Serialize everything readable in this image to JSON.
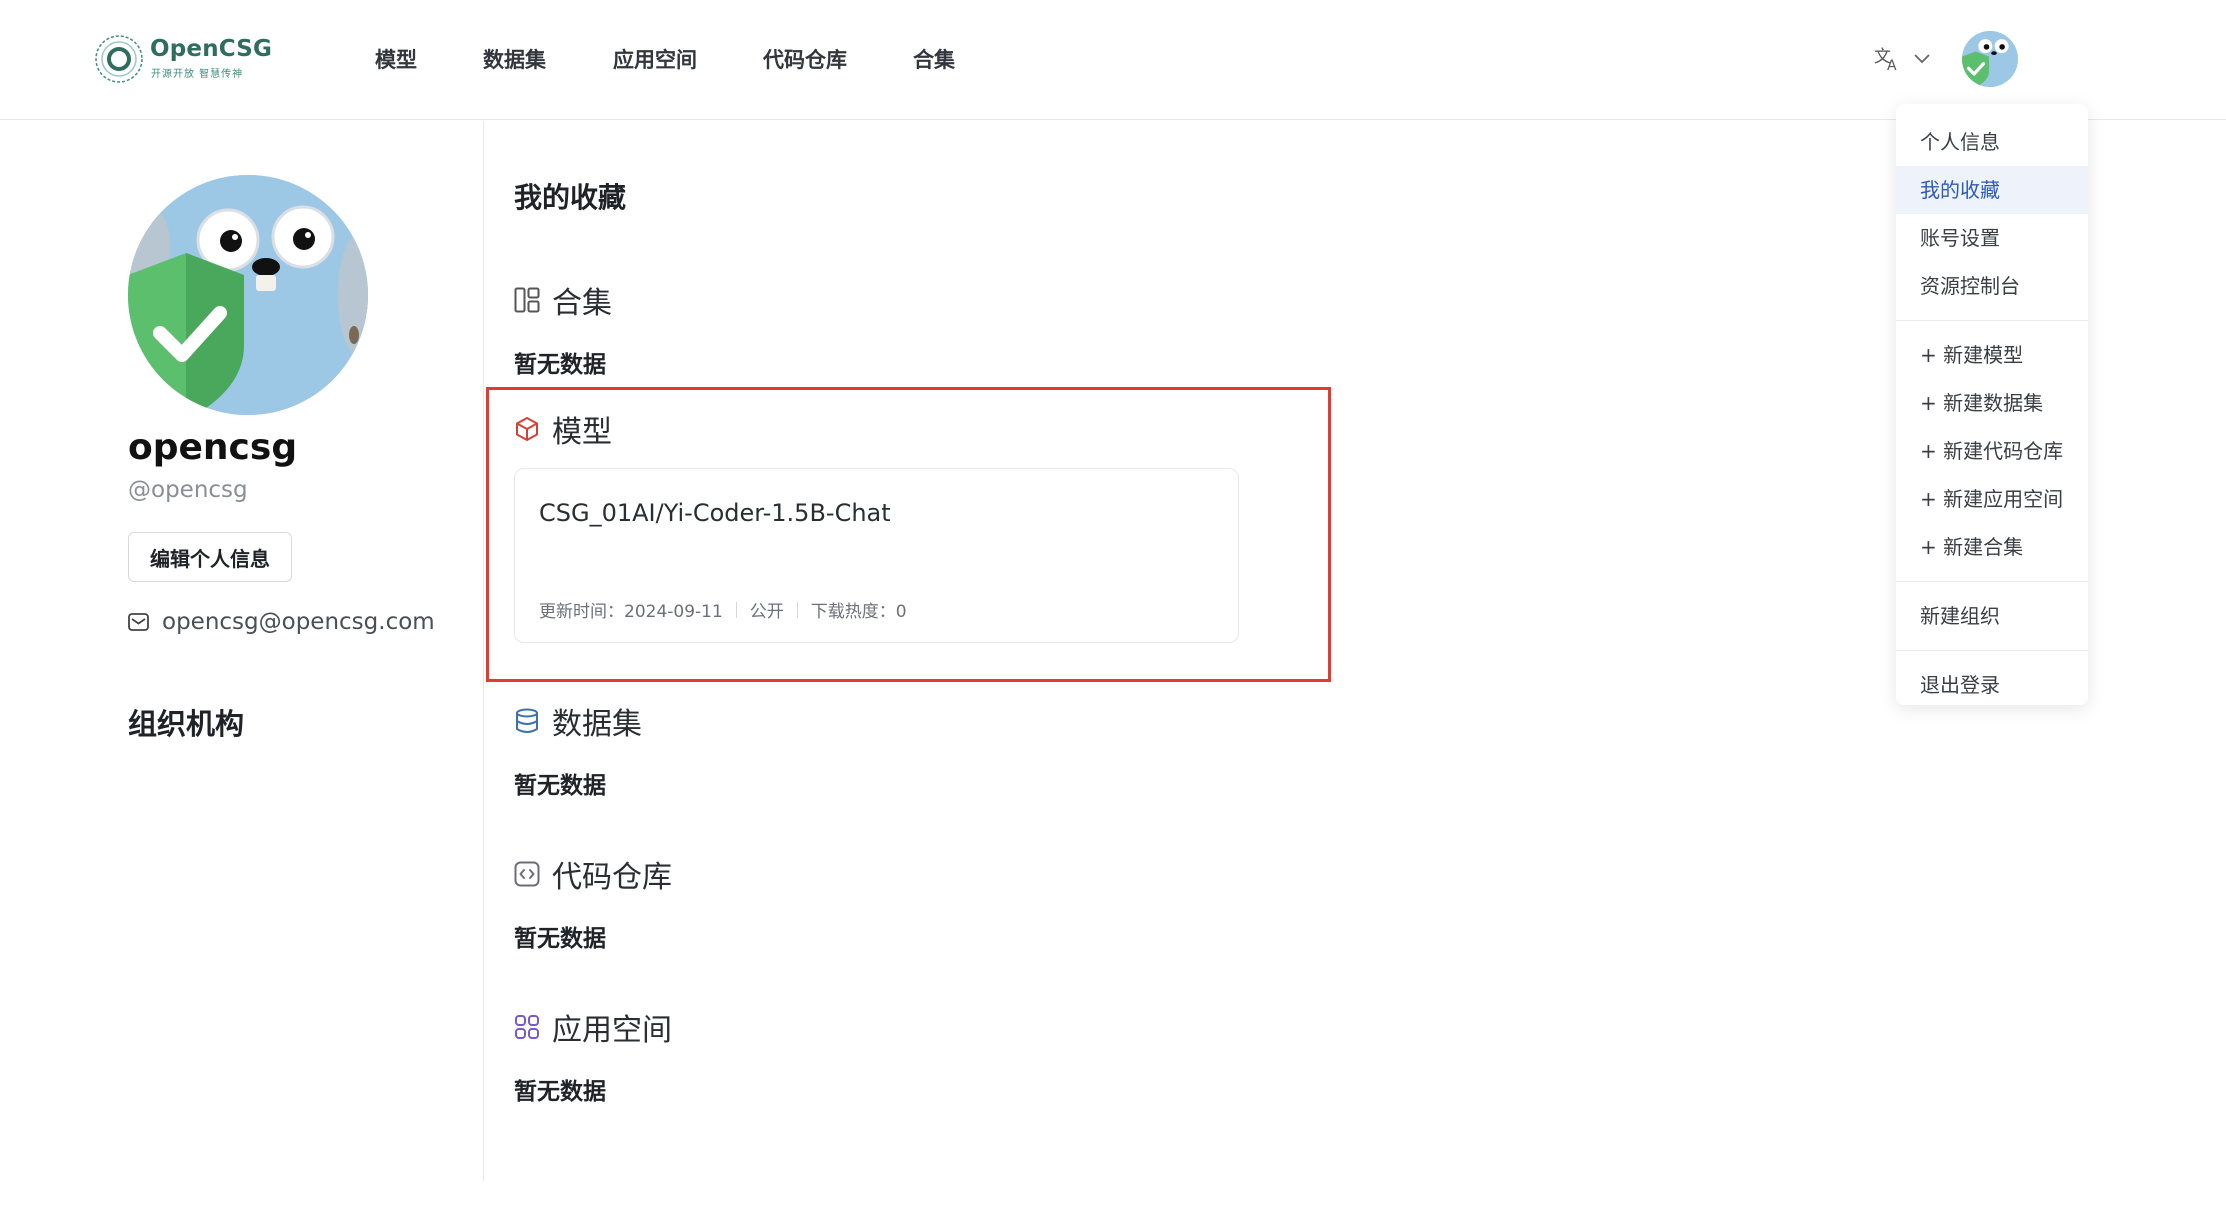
{
  "header": {
    "logo": {
      "title": "OpenCSG",
      "subtitle": "开源开放 智慧传神"
    },
    "nav": [
      "模型",
      "数据集",
      "应用空间",
      "代码仓库",
      "合集"
    ],
    "language_icon": "translate-icon"
  },
  "user_menu": {
    "items": [
      "个人信息",
      "我的收藏",
      "账号设置",
      "资源控制台"
    ],
    "create_items": [
      "+ 新建模型",
      "+ 新建数据集",
      "+ 新建代码仓库",
      "+ 新建应用空间",
      "+ 新建合集"
    ],
    "org_item": "新建组织",
    "logout": "退出登录",
    "active_index": 1
  },
  "profile": {
    "name": "opencsg",
    "handle": "@opencsg",
    "edit_label": "编辑个人信息",
    "email": "opencsg@opencsg.com",
    "org_title": "组织机构"
  },
  "main": {
    "title": "我的收藏",
    "sections": {
      "collections": {
        "label": "合集",
        "empty": "暂无数据"
      },
      "models": {
        "label": "模型"
      },
      "datasets": {
        "label": "数据集",
        "empty": "暂无数据"
      },
      "code": {
        "label": "代码仓库",
        "empty": "暂无数据"
      },
      "spaces": {
        "label": "应用空间",
        "empty": "暂无数据"
      }
    },
    "model_card": {
      "title": "CSG_01AI/Yi-Coder-1.5B-Chat",
      "updated": "更新时间：2024-09-11",
      "visibility": "公开",
      "downloads": "下载热度：0"
    }
  },
  "colors": {
    "brand": "#2f6d5f",
    "active_menu_bg": "#eef3fb",
    "active_menu_text": "#2d5ab8",
    "highlight_border": "#e33b2e"
  }
}
